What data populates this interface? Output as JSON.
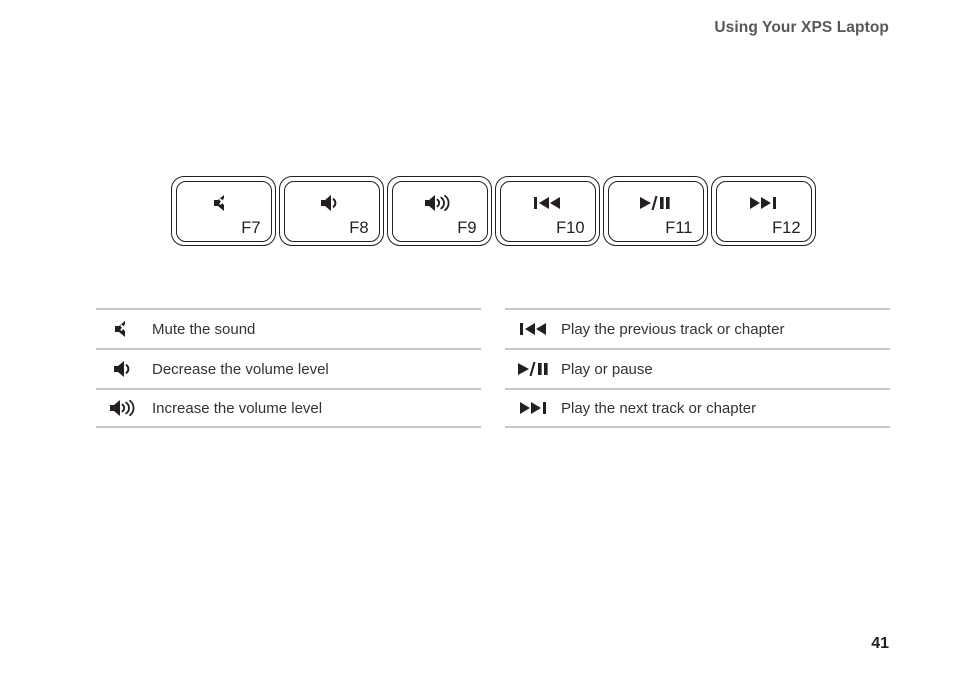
{
  "header": {
    "title": "Using Your XPS Laptop"
  },
  "keys": [
    {
      "label": "F7",
      "icon": "volume-mute-icon"
    },
    {
      "label": "F8",
      "icon": "volume-down-icon"
    },
    {
      "label": "F9",
      "icon": "volume-up-icon"
    },
    {
      "label": "F10",
      "icon": "previous-track-icon"
    },
    {
      "label": "F11",
      "icon": "play-pause-icon"
    },
    {
      "label": "F12",
      "icon": "next-track-icon"
    }
  ],
  "legend_left": [
    {
      "icon": "volume-mute-icon",
      "text": "Mute the sound"
    },
    {
      "icon": "volume-down-icon",
      "text": "Decrease the volume level"
    },
    {
      "icon": "volume-up-icon",
      "text": "Increase the volume level"
    }
  ],
  "legend_right": [
    {
      "icon": "previous-track-icon",
      "text": "Play the previous track or chapter"
    },
    {
      "icon": "play-pause-icon",
      "text": "Play or pause"
    },
    {
      "icon": "next-track-icon",
      "text": "Play the next track or chapter"
    }
  ],
  "footer": {
    "page_number": "41"
  },
  "colors": {
    "header_text": "#58585a",
    "body_text": "#333333",
    "rule": "#c7c8ca",
    "ink": "#231f20",
    "background": "#ffffff"
  }
}
